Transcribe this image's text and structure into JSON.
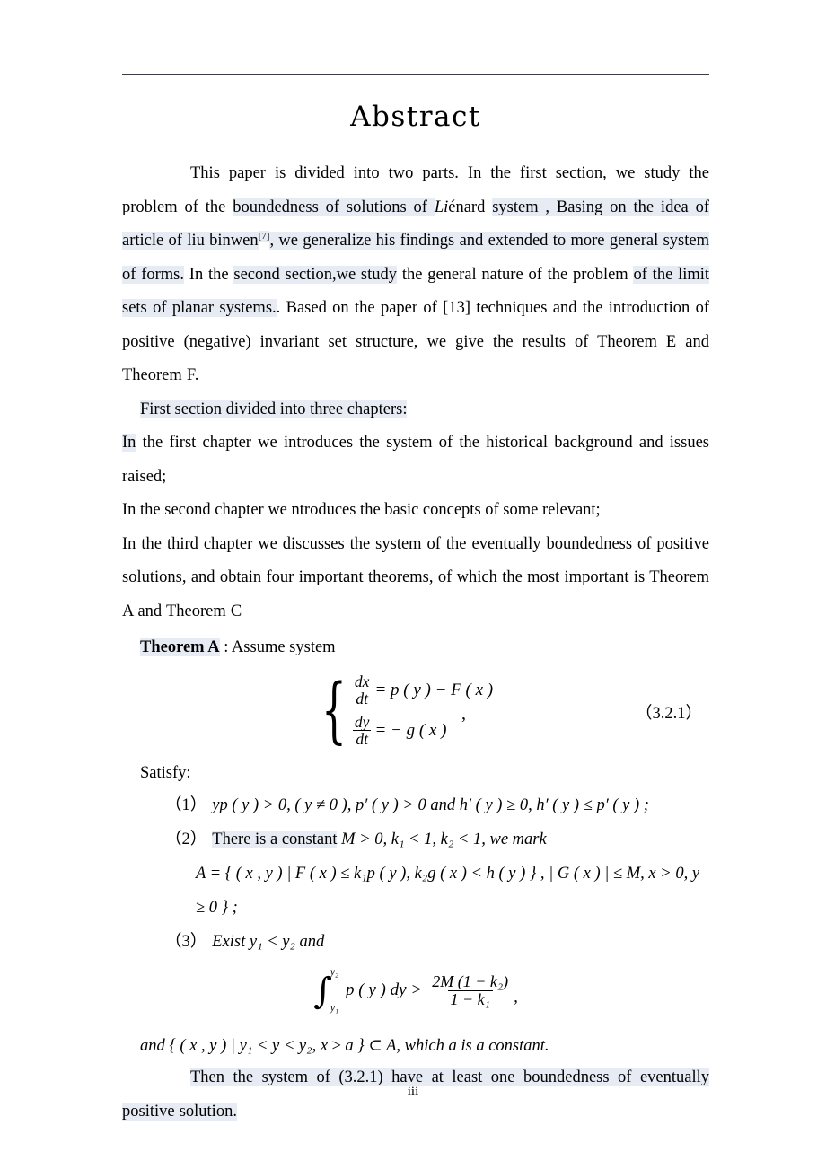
{
  "document": {
    "title": "Abstract",
    "page_number": "iii",
    "highlight_color": "#e6ebf4",
    "rule_color": "#403a48"
  },
  "paragraph1": {
    "seg1": "This paper is divided into two parts. In the first section, we study the problem of the ",
    "seg2_hl": "boundedness of solutions of ",
    "seg3_italic": "Li",
    "seg4": "énard ",
    "seg5_hl": "system , Basing on the idea of article of liu binwen",
    "seg6_ref": "[7]",
    "seg7_hl": ", we generalize his findings and extended to more general system of forms.",
    "seg8": " In the ",
    "seg9_hl": "second section,we study",
    "seg10": " the general nature of the problem ",
    "seg11_hl": "of the limit sets of planar systems.",
    "seg12": ". Based on the paper of [13] techniques and the introduction of positive (negative) invariant set structure, we give the results of Theorem E and Theorem F."
  },
  "paragraph2": {
    "text_hl": "First section divided into three chapters:"
  },
  "chapters": {
    "line1_hl_prefix": "In",
    "line1_rest": " the first chapter we introduces the system of the historical background and issues raised;",
    "line2": "In the second chapter we ntroduces the basic concepts of some relevant;",
    "line3": "In the third chapter we discusses the system of the eventually boundedness of positive solutions, and obtain four important theorems, of which the most important is Theorem A and Theorem C"
  },
  "theorem": {
    "name_hl": "Theorem A",
    "intro": " : Assume system",
    "equation": {
      "row1": {
        "frac_num": "dx",
        "frac_den": "dt",
        "rhs": "= p ( y ) − F ( x )"
      },
      "row2": {
        "frac_num": "dy",
        "frac_den": "dt",
        "rhs": "= − g ( x )"
      },
      "comma": ",",
      "number": "（3.2.1）"
    },
    "satisfy_label": "Satisfy:",
    "conditions": [
      {
        "label": "（1）",
        "text": "yp ( y ) > 0, ( y ≠ 0 ),  p′ ( y ) > 0  and  h′ ( y ) ≥ 0, h′ ( y ) ≤ p′ ( y ) ;"
      },
      {
        "label": "（2）",
        "text_hl": "There is a constant",
        "text_rest": "  M > 0, k₁ < 1, k₂ < 1, we mark"
      },
      {
        "label": "（3）",
        "text": "Exist y₁ < y₂ and"
      }
    ],
    "set_a": "A = { ( x , y ) | F ( x ) ≤ k₁p ( y ), k₂g ( x ) < h ( y ) } , | G ( x ) | ≤ M, x > 0, y ≥ 0 } ;",
    "integral": {
      "lower": "y₁",
      "upper": "y₂",
      "integrand": "p ( y ) dy",
      "relation": ">",
      "frac_num": "2M (1 − k₂)",
      "frac_den": "1 − k₁",
      "trailing_comma": ","
    },
    "and_line": "and { ( x , y ) | y₁ < y < y₂,  x ≥ a } ⊂ A, which  a is a constant.",
    "conclusion_hl": "Then the system of (3.2.1) have at least one boundedness of eventually positive solution."
  }
}
